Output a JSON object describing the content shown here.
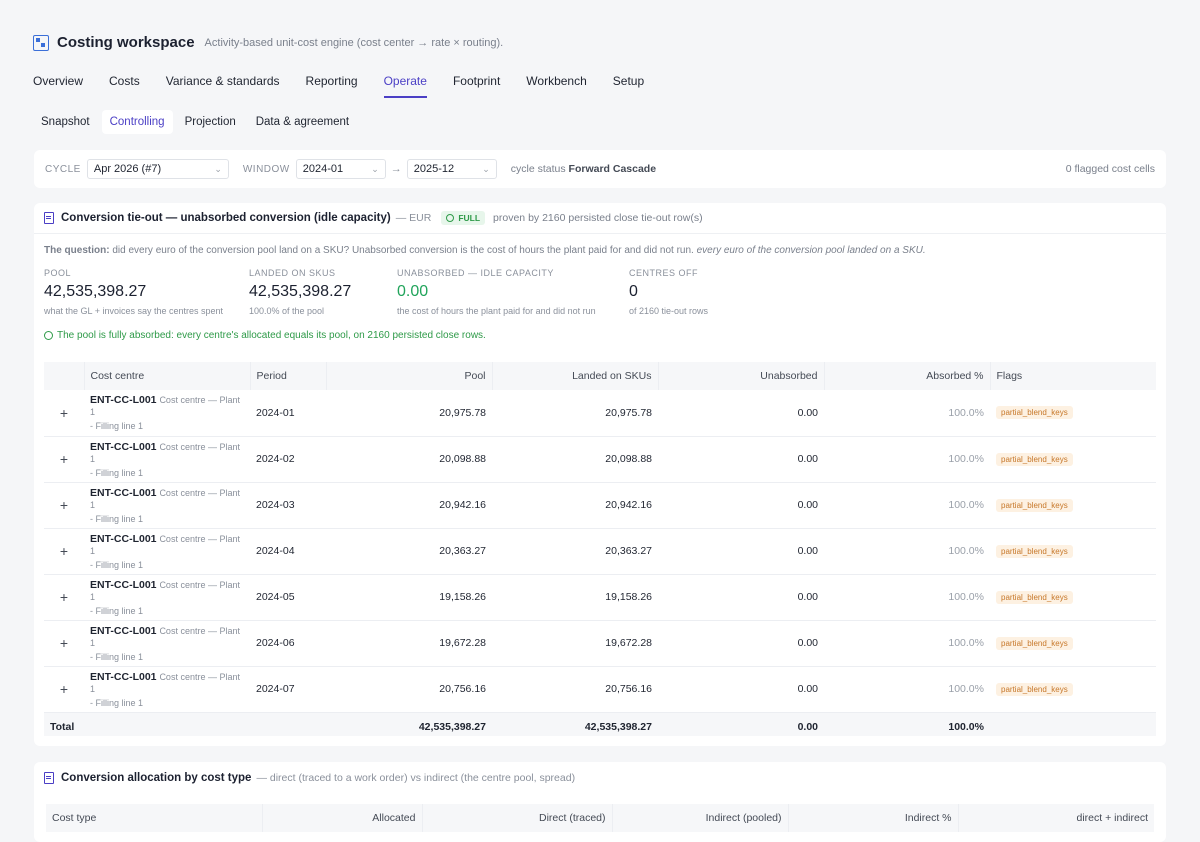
{
  "app": {
    "title": "Costing workspace",
    "subtitle": "Activity-based unit-cost engine (cost center → rate × routing)."
  },
  "main_tabs": [
    "Overview",
    "Costs",
    "Variance & standards",
    "Reporting",
    "Operate",
    "Footprint",
    "Workbench",
    "Setup"
  ],
  "main_tab_active": "Operate",
  "sub_tabs": [
    "Snapshot",
    "Controlling",
    "Projection",
    "Data & agreement"
  ],
  "sub_tab_active": "Controlling",
  "filters": {
    "cycle_label": "CYCLE",
    "cycle_value": "Apr 2026 (#7)",
    "window_label": "WINDOW",
    "window_from": "2024-01",
    "window_arrow": "→",
    "window_to": "2025-12",
    "cycle_status_label": "cycle status",
    "cycle_status_value": "Forward Cascade",
    "flagged": "0 flagged cost cells"
  },
  "tieout": {
    "title": "Conversion tie-out — unabsorbed conversion (idle capacity)",
    "currency": "— EUR",
    "badge": "FULL",
    "proven": "proven by 2160 persisted close tie-out row(s)",
    "question_label": "The question:",
    "question_text": "did every euro of the conversion pool land on a SKU? Unabsorbed conversion is the cost of hours the plant paid for and did not run.",
    "question_answer": "every euro of the conversion pool landed on a SKU.",
    "metrics": [
      {
        "label": "POOL",
        "value": "42,535,398.27",
        "sub": "what the GL + invoices say the centres spent"
      },
      {
        "label": "LANDED ON SKUS",
        "value": "42,535,398.27",
        "sub": "100.0% of the pool"
      },
      {
        "label": "UNABSORBED — IDLE CAPACITY",
        "value": "0.00",
        "sub": "the cost of hours the plant paid for and did not run"
      },
      {
        "label": "CENTRES OFF",
        "value": "0",
        "sub": "of 2160 tie-out rows"
      }
    ],
    "absorbed_note": "The pool is fully absorbed: every centre's allocated equals its pool, on 2160 persisted close rows.",
    "columns": [
      "Cost centre",
      "Period",
      "Pool",
      "Landed on SKUs",
      "Unabsorbed",
      "Absorbed %",
      "Flags"
    ],
    "rows": [
      {
        "code": "ENT-CC-L001",
        "desc": "Cost centre — Plant 1",
        "line": "- Filling line 1",
        "period": "2024-01",
        "pool": "20,975.78",
        "landed": "20,975.78",
        "unabsorbed": "0.00",
        "absorbed": "100.0%",
        "flag": "partial_blend_keys"
      },
      {
        "code": "ENT-CC-L001",
        "desc": "Cost centre — Plant 1",
        "line": "- Filling line 1",
        "period": "2024-02",
        "pool": "20,098.88",
        "landed": "20,098.88",
        "unabsorbed": "0.00",
        "absorbed": "100.0%",
        "flag": "partial_blend_keys"
      },
      {
        "code": "ENT-CC-L001",
        "desc": "Cost centre — Plant 1",
        "line": "- Filling line 1",
        "period": "2024-03",
        "pool": "20,942.16",
        "landed": "20,942.16",
        "unabsorbed": "0.00",
        "absorbed": "100.0%",
        "flag": "partial_blend_keys"
      },
      {
        "code": "ENT-CC-L001",
        "desc": "Cost centre — Plant 1",
        "line": "- Filling line 1",
        "period": "2024-04",
        "pool": "20,363.27",
        "landed": "20,363.27",
        "unabsorbed": "0.00",
        "absorbed": "100.0%",
        "flag": "partial_blend_keys"
      },
      {
        "code": "ENT-CC-L001",
        "desc": "Cost centre — Plant 1",
        "line": "- Filling line 1",
        "period": "2024-05",
        "pool": "19,158.26",
        "landed": "19,158.26",
        "unabsorbed": "0.00",
        "absorbed": "100.0%",
        "flag": "partial_blend_keys"
      },
      {
        "code": "ENT-CC-L001",
        "desc": "Cost centre — Plant 1",
        "line": "- Filling line 1",
        "period": "2024-06",
        "pool": "19,672.28",
        "landed": "19,672.28",
        "unabsorbed": "0.00",
        "absorbed": "100.0%",
        "flag": "partial_blend_keys"
      },
      {
        "code": "ENT-CC-L001",
        "desc": "Cost centre — Plant 1",
        "line": "- Filling line 1",
        "period": "2024-07",
        "pool": "20,756.16",
        "landed": "20,756.16",
        "unabsorbed": "0.00",
        "absorbed": "100.0%",
        "flag": "partial_blend_keys"
      }
    ],
    "total": {
      "label": "Total",
      "pool": "42,535,398.27",
      "landed": "42,535,398.27",
      "unabsorbed": "0.00",
      "absorbed": "100.0%"
    }
  },
  "allocation": {
    "title": "Conversion allocation by cost type",
    "subtitle": "— direct (traced to a work order) vs indirect (the centre pool, spread)",
    "columns": [
      "Cost type",
      "Allocated",
      "Direct (traced)",
      "Indirect (pooled)",
      "Indirect %",
      "direct + indirect"
    ]
  },
  "colors": {
    "accent": "#4b3fc5",
    "success": "#21a45b",
    "flag": "#c7782a"
  }
}
